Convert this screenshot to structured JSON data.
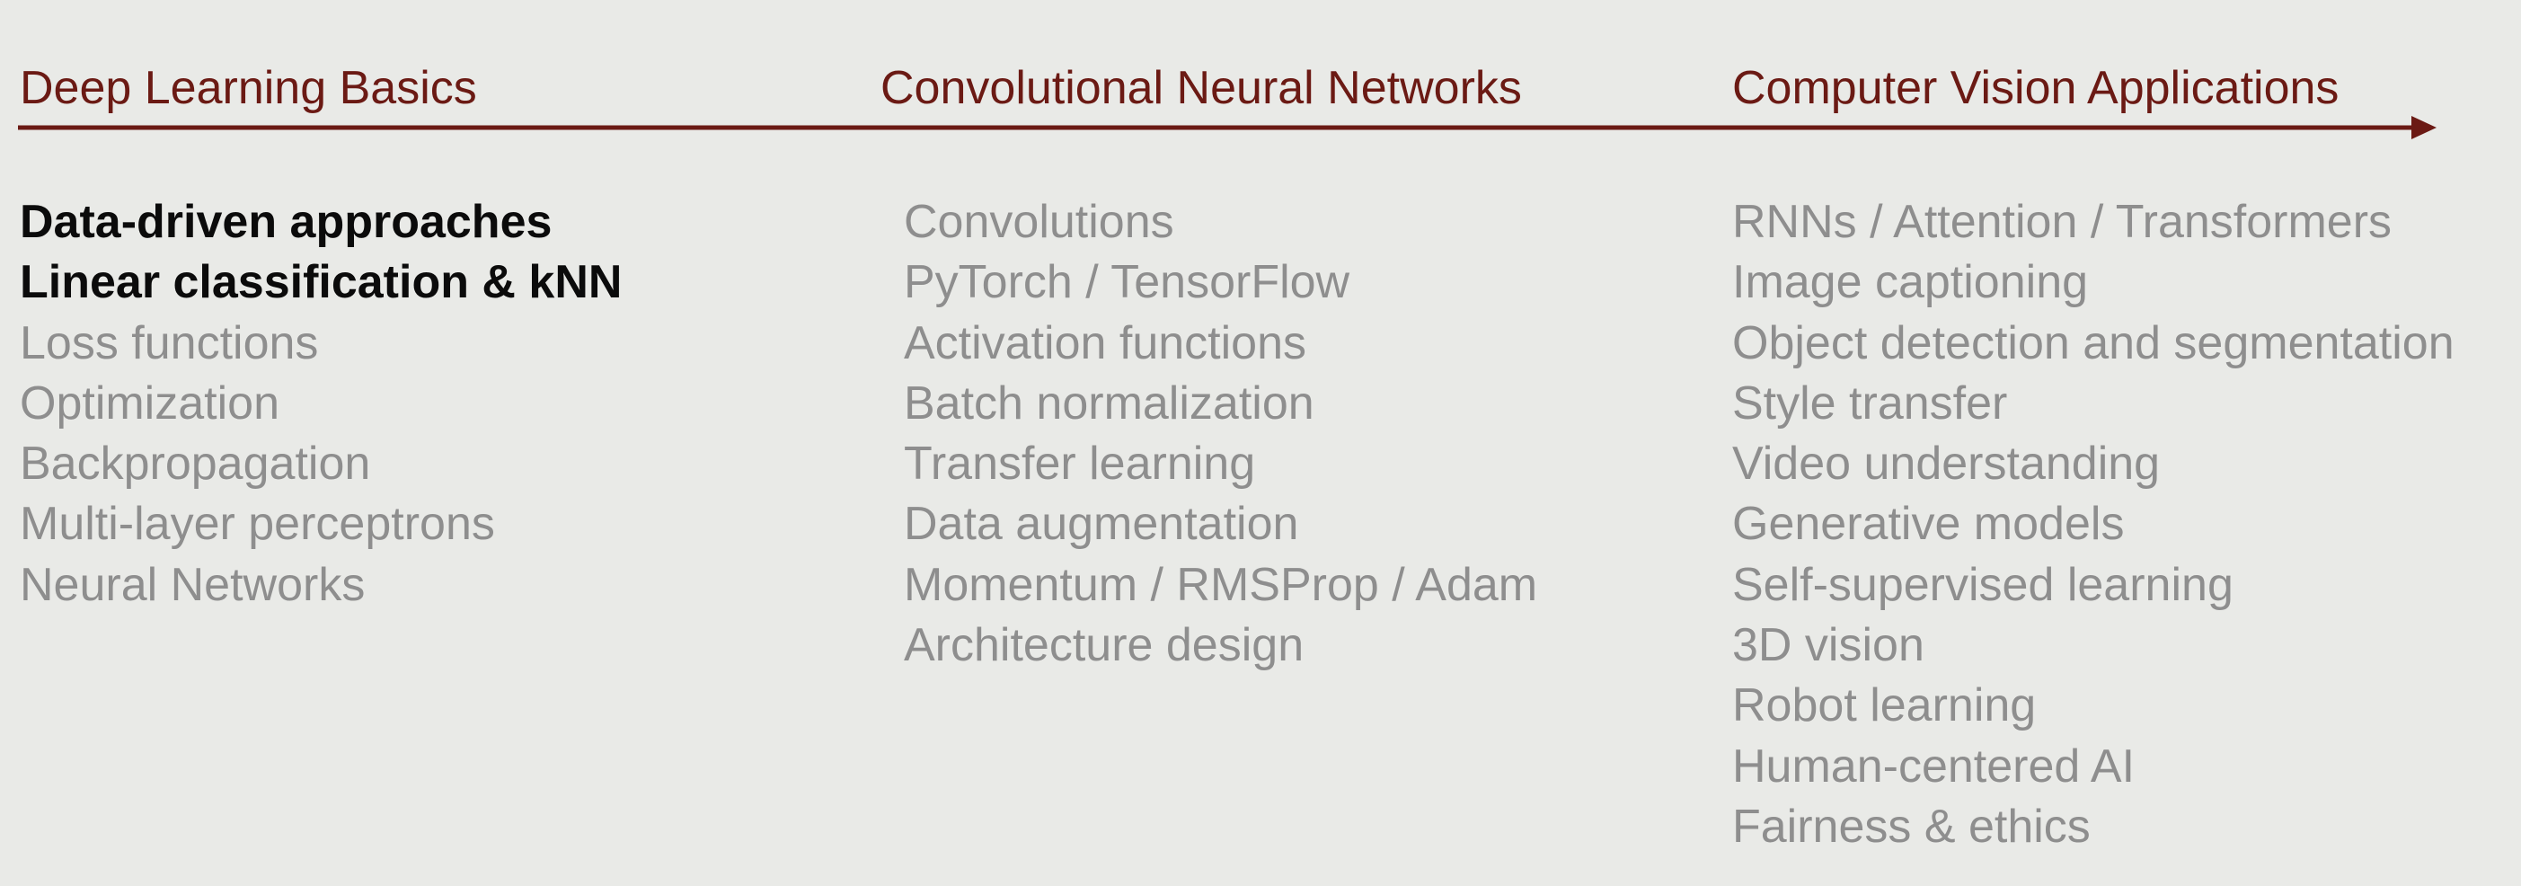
{
  "section_headings": [
    "Deep Learning Basics",
    "Convolutional Neural Networks",
    "Computer Vision Applications"
  ],
  "columns": [
    {
      "items": [
        {
          "label": "Data-driven approaches",
          "current": true
        },
        {
          "label": "Linear classification & kNN",
          "current": true
        },
        {
          "label": "Loss functions",
          "current": false
        },
        {
          "label": "Optimization",
          "current": false
        },
        {
          "label": "Backpropagation",
          "current": false
        },
        {
          "label": "Multi-layer perceptrons",
          "current": false
        },
        {
          "label": "Neural Networks",
          "current": false
        }
      ]
    },
    {
      "items": [
        {
          "label": "Convolutions",
          "current": false
        },
        {
          "label": "PyTorch / TensorFlow",
          "current": false
        },
        {
          "label": "Activation functions",
          "current": false
        },
        {
          "label": "Batch normalization",
          "current": false
        },
        {
          "label": "Transfer learning",
          "current": false
        },
        {
          "label": "Data augmentation",
          "current": false
        },
        {
          "label": "Momentum / RMSProp / Adam",
          "current": false
        },
        {
          "label": "Architecture design",
          "current": false
        }
      ]
    },
    {
      "items": [
        {
          "label": "RNNs / Attention / Transformers",
          "current": false
        },
        {
          "label": "Image captioning",
          "current": false
        },
        {
          "label": "Object detection and segmentation",
          "current": false
        },
        {
          "label": "Style transfer",
          "current": false
        },
        {
          "label": "Video understanding",
          "current": false
        },
        {
          "label": "Generative models",
          "current": false
        },
        {
          "label": "Self-supervised learning",
          "current": false
        },
        {
          "label": "3D vision",
          "current": false
        },
        {
          "label": "Robot learning",
          "current": false
        },
        {
          "label": "Human-centered AI",
          "current": false
        },
        {
          "label": "Fairness & ethics",
          "current": false
        }
      ]
    }
  ],
  "colors": {
    "background": "#e9eae7",
    "heading": "#6b1a14",
    "timeline_arrow": "#6b1a14",
    "current_topic": "#0b0b0b",
    "upcoming_topic": "#8e8e8e"
  }
}
